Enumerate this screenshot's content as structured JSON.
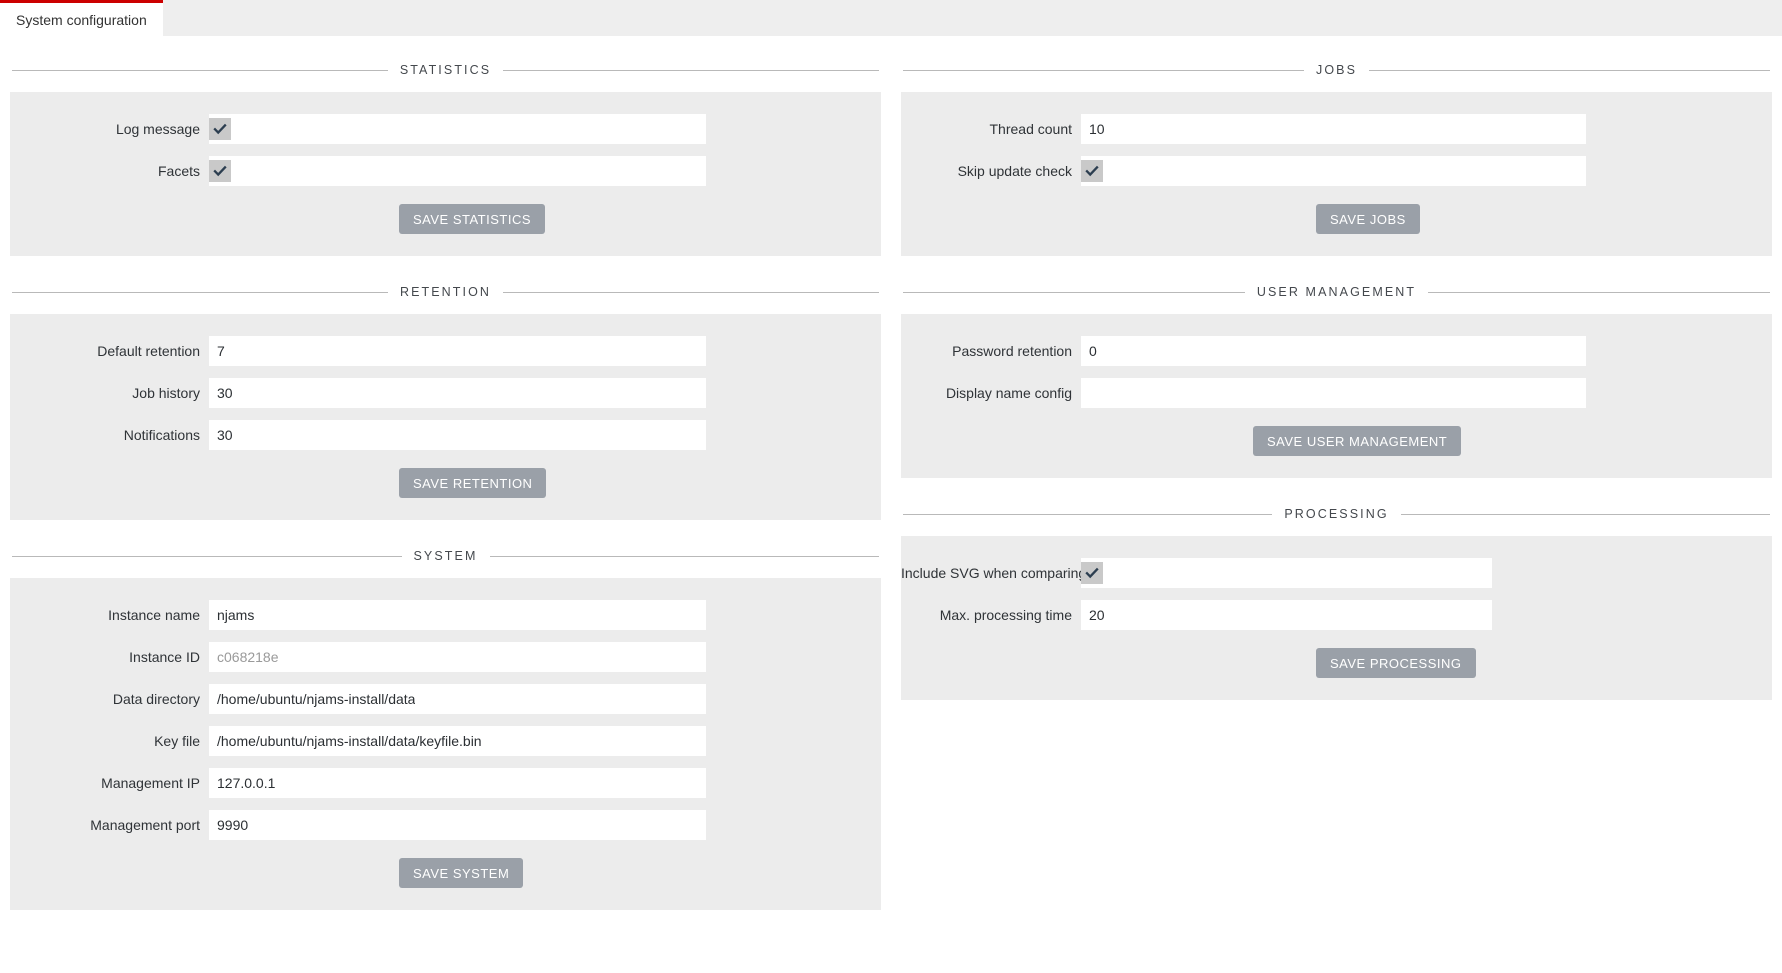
{
  "tab": {
    "label": "System configuration",
    "accent_color": "#cc0000"
  },
  "theme": {
    "panel_bg": "#ececec",
    "field_bg": "#ffffff",
    "button_bg": "#9aa0a8",
    "rule_color": "#b9b9b9",
    "checkbox_bg": "#c9c9c9",
    "check_color": "#2c3e50"
  },
  "sections": {
    "statistics": {
      "title": "STATISTICS",
      "fields": [
        {
          "label": "Log message",
          "type": "checkbox",
          "checked": true
        },
        {
          "label": "Facets",
          "type": "checkbox",
          "checked": true
        }
      ],
      "save_label": "SAVE STATISTICS"
    },
    "jobs": {
      "title": "JOBS",
      "fields": [
        {
          "label": "Thread count",
          "type": "text",
          "value": "10"
        },
        {
          "label": "Skip update check",
          "type": "checkbox",
          "checked": true
        }
      ],
      "save_label": "SAVE JOBS"
    },
    "retention": {
      "title": "RETENTION",
      "fields": [
        {
          "label": "Default retention",
          "type": "text",
          "value": "7"
        },
        {
          "label": "Job history",
          "type": "text",
          "value": "30"
        },
        {
          "label": "Notifications",
          "type": "text",
          "value": "30"
        }
      ],
      "save_label": "SAVE RETENTION"
    },
    "user_management": {
      "title": "USER MANAGEMENT",
      "fields": [
        {
          "label": "Password retention",
          "type": "text",
          "value": "0"
        },
        {
          "label": "Display name config",
          "type": "text",
          "value": ""
        }
      ],
      "save_label": "SAVE USER MANAGEMENT"
    },
    "system": {
      "title": "SYSTEM",
      "fields": [
        {
          "label": "Instance name",
          "type": "text",
          "value": "njams"
        },
        {
          "label": "Instance ID",
          "type": "text",
          "value": "c068218e",
          "muted": true
        },
        {
          "label": "Data directory",
          "type": "text",
          "value": "/home/ubuntu/njams-install/data"
        },
        {
          "label": "Key file",
          "type": "text",
          "value": "/home/ubuntu/njams-install/data/keyfile.bin"
        },
        {
          "label": "Management IP",
          "type": "text",
          "value": "127.0.0.1"
        },
        {
          "label": "Management port",
          "type": "text",
          "value": "9990"
        }
      ],
      "save_label": "SAVE SYSTEM"
    },
    "processing": {
      "title": "PROCESSING",
      "fields": [
        {
          "label": "Include SVG when comparing process models",
          "type": "checkbox",
          "checked": true
        },
        {
          "label": "Max. processing time",
          "type": "text",
          "value": "20"
        }
      ],
      "save_label": "SAVE PROCESSING"
    }
  }
}
